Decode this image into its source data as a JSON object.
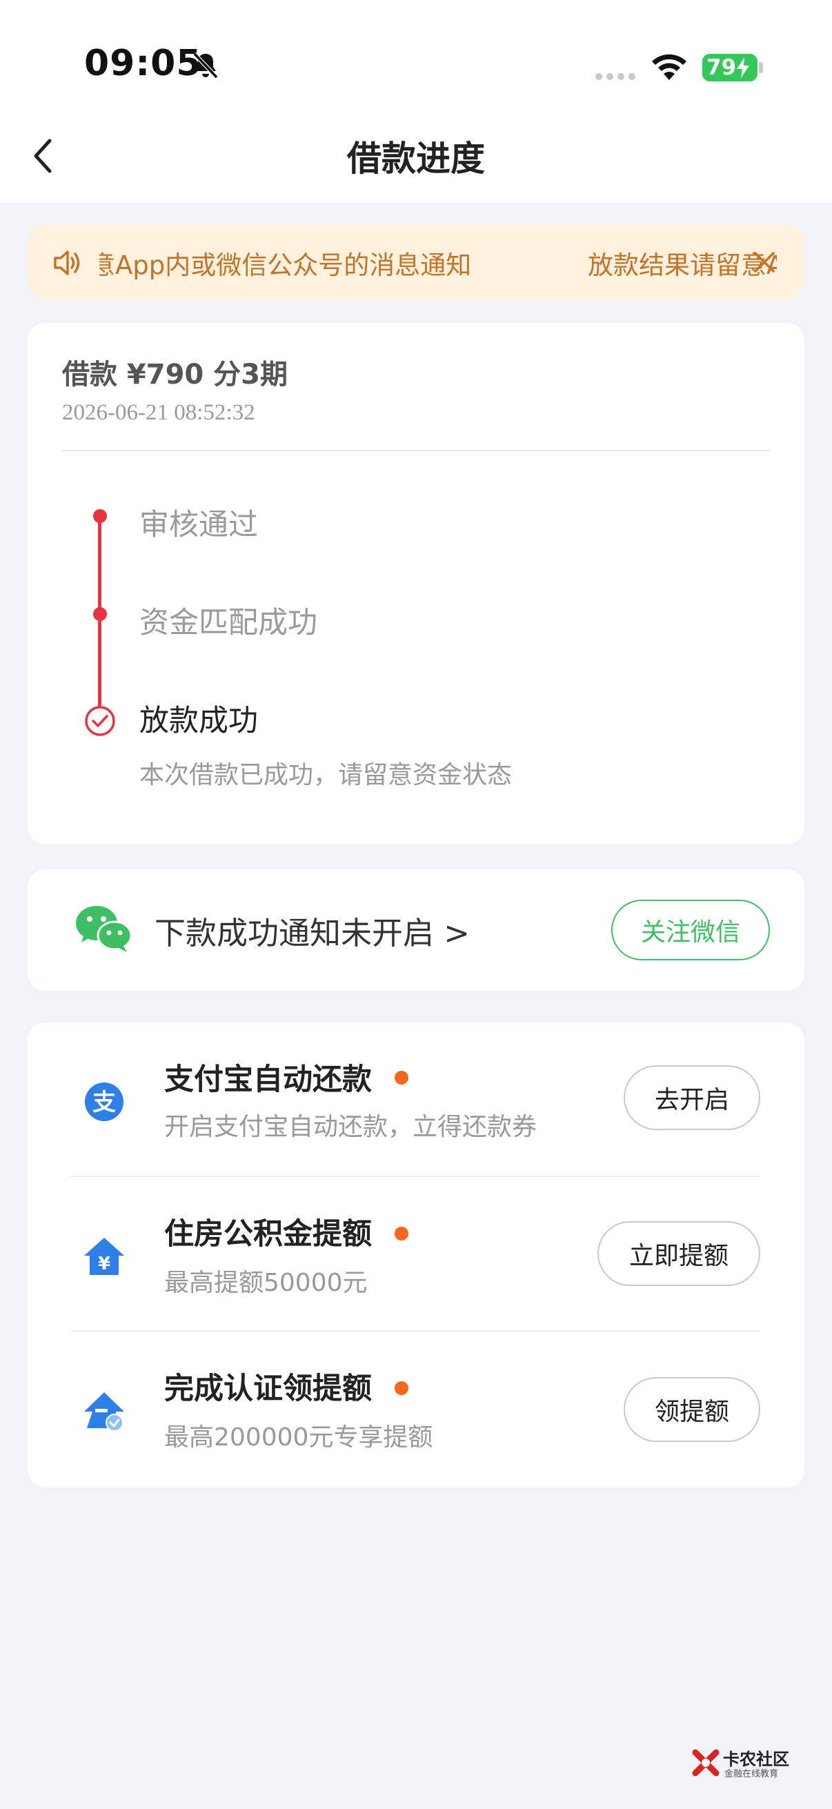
{
  "status_bar": {
    "time": "09:05",
    "battery": "79"
  },
  "header": {
    "title": "借款进度"
  },
  "notice": {
    "text_1": "请留意App内或微信公众号的消息通知",
    "text_2": "放款结果请留意App内或微信公众号的消息通知"
  },
  "loan": {
    "title": "借款 ¥790  分3期",
    "datetime": "2026-06-21 08:52:32",
    "steps": [
      {
        "label": "审核通过"
      },
      {
        "label": "资金匹配成功"
      },
      {
        "label": "放款成功",
        "desc": "本次借款已成功，请留意资金状态"
      }
    ]
  },
  "wechat": {
    "text": "下款成功通知未开启 >",
    "button": "关注微信"
  },
  "services": [
    {
      "title": "支付宝自动还款",
      "desc": "开启支付宝自动还款，立得还款券",
      "button": "去开启",
      "icon": "alipay-icon"
    },
    {
      "title": "住房公积金提额",
      "desc": "最高提额50000元",
      "button": "立即提额",
      "icon": "housing-fund-icon"
    },
    {
      "title": "完成认证领提额",
      "desc": "最高200000元专享提额",
      "button": "领提额",
      "icon": "verify-upgrade-icon"
    }
  ],
  "watermark": {
    "title": "卡农社区",
    "subtitle": "金融在线教育"
  },
  "colors": {
    "accent_red": "#e8343e",
    "wechat_green": "#3fbf64",
    "notice_bg": "#fff1dd",
    "notice_text": "#c2742a",
    "dot_orange": "#f5681b"
  }
}
